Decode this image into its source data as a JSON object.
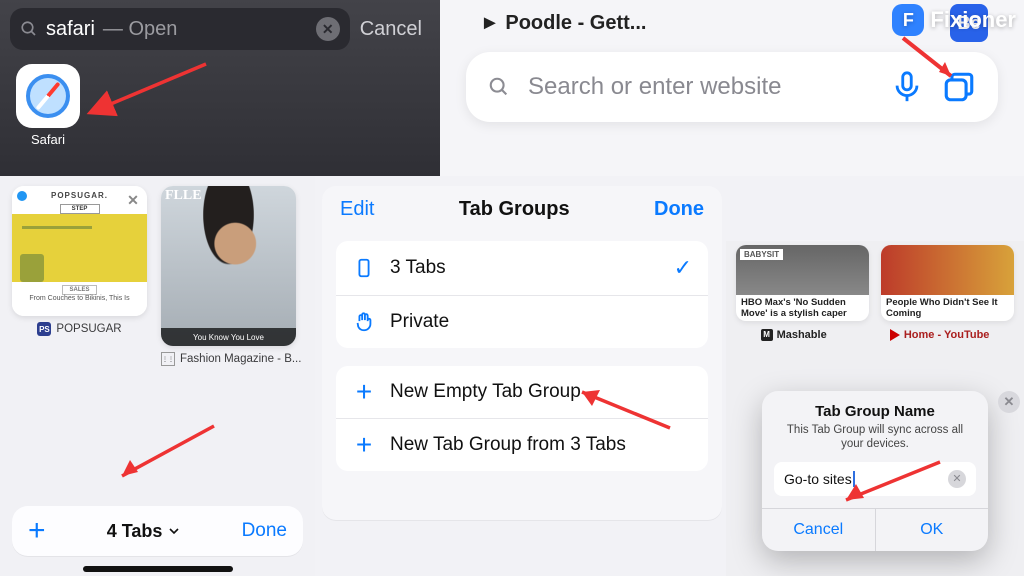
{
  "watermark": "Fixioner",
  "spotlight": {
    "term": "safari",
    "hint": " — Open",
    "cancel": "Cancel",
    "app_label": "Safari"
  },
  "safari_bar": {
    "tab_preview": "► Poodle - Gett...",
    "placeholder": "Search or enter website"
  },
  "tab_overview": {
    "thumbs": [
      {
        "header": "POPSUGAR.",
        "sub": "STEP",
        "caption": "From Couches to Bikinis, This Is",
        "site": "POPSUGAR",
        "sale": "SALES"
      },
      {
        "header": "FLLE",
        "caption": "You Know You Love",
        "site": "Fashion Magazine - B..."
      }
    ],
    "count_label": "4 Tabs",
    "done": "Done"
  },
  "tab_groups": {
    "edit": "Edit",
    "title": "Tab Groups",
    "done": "Done",
    "items": {
      "current": "3 Tabs",
      "private": "Private",
      "new_empty": "New Empty Tab Group",
      "new_from": "New Tab Group from 3 Tabs"
    }
  },
  "bottom_right": {
    "cards": [
      {
        "badge": "BABYSIT",
        "headline": "HBO Max's 'No Sudden Move' is a stylish caper"
      },
      {
        "headline": "People Who Didn't See It Coming"
      }
    ],
    "sites": {
      "mashable": "Mashable",
      "youtube": "Home - YouTube"
    },
    "dialog": {
      "title": "Tab Group Name",
      "subtitle": "This Tab Group will sync across all your devices.",
      "value": "Go-to sites",
      "cancel": "Cancel",
      "ok": "OK"
    }
  }
}
